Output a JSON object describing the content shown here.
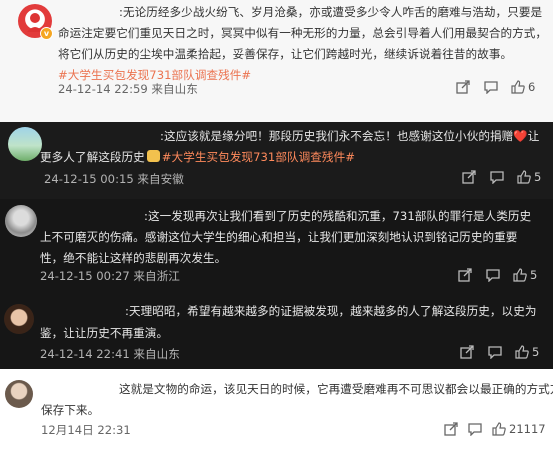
{
  "comments": [
    {
      "lines": [
        [
          ":无论历经多少战火纷飞、岁月沧桑，亦或遭受多少令人咋舌的磨难与浩劫，只要是"
        ],
        [
          "命运注定要它们重见天日之时，冥冥中似有一种无形的力量，总会引导着人们用最契合的方式，"
        ],
        [
          "将它们从历史的尘埃中温柔拾起，妥善保存，让它们跨越时光，继续诉说着往昔的故事。"
        ],
        [
          "#大学生买包发现731部队调查残件#"
        ]
      ],
      "time": "24-12-14 22:59 来自山东",
      "like_count": "6"
    },
    {
      "lines": [
        [
          ":这应该就是缘分吧！那段历史我们永不会忘！也感谢这位小伙的捐赠"
        ],
        [
          "更多人了解这段历史",
          "#大学生买包发现731部队调查残件#"
        ]
      ],
      "emoji_heart": "❤️",
      "line1_tail": "让",
      "time": "24-12-15 00:15 来自安徽",
      "like_count": "5"
    },
    {
      "lines": [
        [
          ":这一发现再次让我们看到了历史的残酷和沉重，731部队的罪行是人类历史"
        ],
        [
          "上不可磨灭的伤痛。感谢这位大学生的细心和担当，让我们更加深刻地认识到铭记历史的重要"
        ],
        [
          "性，绝不能让这样的悲剧再次发生。"
        ]
      ],
      "time": "24-12-15 00:27 来自浙江",
      "like_count": "5"
    },
    {
      "lines": [
        [
          ":天理昭昭，希望有越来越多的证据被发现，越来越多的人了解这段历史，以史为"
        ],
        [
          "鉴，让让历史不再重演。"
        ]
      ],
      "time": "24-12-14 22:41 来自山东",
      "like_count": "5"
    },
    {
      "lines": [
        [
          "这就是文物的命运，该见天日的时候，它再遭受磨难再不可思议都会以最正确的方式方法"
        ],
        [
          "保存下来。"
        ]
      ],
      "time": "12月14日 22:31",
      "like_count": "21117"
    }
  ],
  "icons": {
    "share": "share-icon",
    "comment": "comment-icon",
    "like": "like-icon"
  },
  "colors": {
    "topic": "#eb7350",
    "topic_dark": "#ff8a5c",
    "badge": "#f5a623"
  }
}
